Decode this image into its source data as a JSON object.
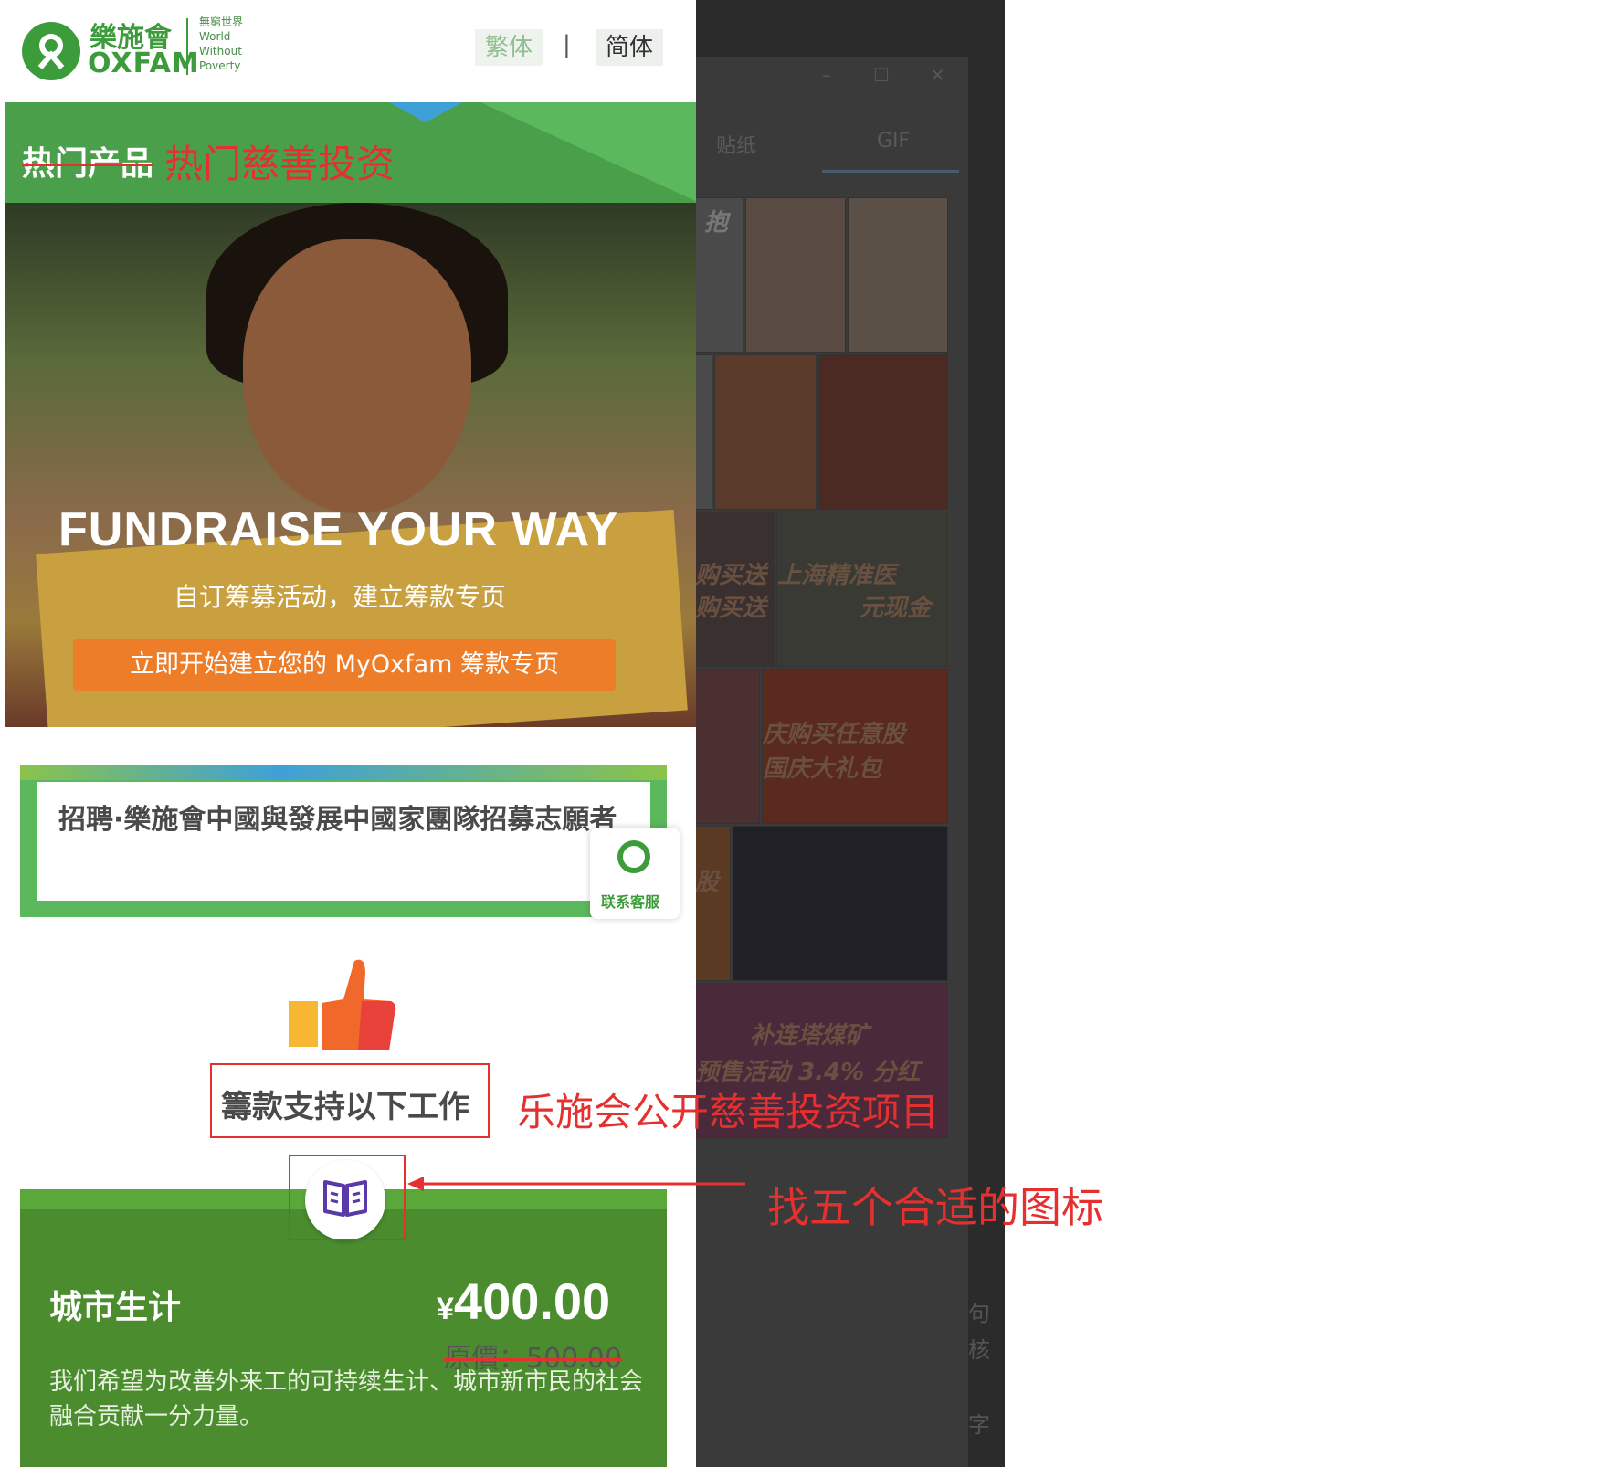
{
  "header": {
    "logo_cn": "樂施會",
    "logo_en": "OXFAM",
    "logo_tagline": [
      "無窮世界",
      "World",
      "Without",
      "Poverty"
    ],
    "lang_traditional": "繁体",
    "lang_separator": "|",
    "lang_simplified": "简体"
  },
  "section": {
    "title_struck": "热门产品",
    "title_annotation": "热门慈善投资"
  },
  "hero": {
    "title": "FUNDRAISE YOUR WAY",
    "subtitle": "自订筹募活动，建立筹款专页",
    "cta": "立即开始建立您的 MyOxfam 筹款专页"
  },
  "recruit": {
    "text": "招聘·樂施會中國與發展中國家團隊招募志願者"
  },
  "customer_service": {
    "label": "联系客服"
  },
  "fund": {
    "label": "籌款支持以下工作",
    "annotation": "乐施会公开慈善投资项目",
    "icon_annotation": "找五个合适的图标"
  },
  "card": {
    "title": "城市生计",
    "currency": "¥",
    "price": "400.00",
    "original_price": "原價：500.00",
    "description": "我们希望为改善外来工的可持续生计、城市新市民的社会融合贡献一分力量。"
  },
  "background_app": {
    "tab_stickers": "贴纸",
    "tab_gif": "GIF",
    "tile_texts": [
      "抱",
      "购买送",
      "购买送",
      "上海精准医",
      "元现金",
      "庆购买任意股",
      "国庆大礼包",
      "补连塔煤矿",
      "预售活动 3.4% 分红",
      "股"
    ],
    "side_texts": [
      "句",
      "核",
      "字"
    ]
  },
  "colors": {
    "oxfam_green": "#3c9c3c",
    "card_green": "#4a8c2e",
    "annotation_red": "#e53030",
    "cta_orange": "#ee7d2a"
  },
  "icons": [
    "oxfam-logo-icon",
    "thumbs-up-icon",
    "book-icon",
    "arrow-left-icon"
  ]
}
